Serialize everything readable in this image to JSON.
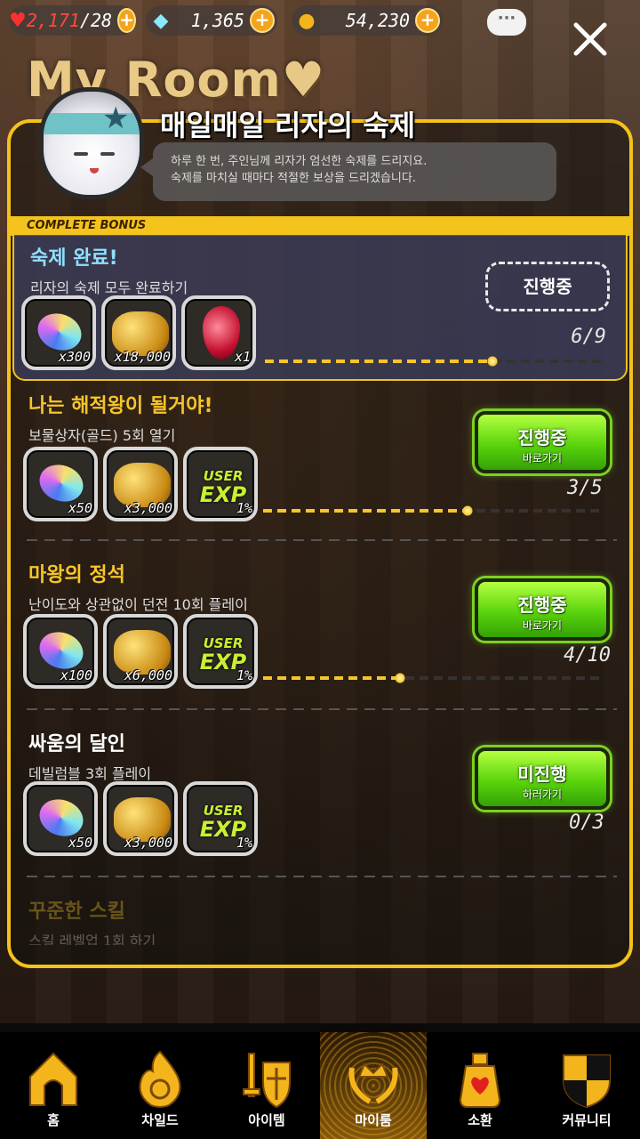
{
  "status": {
    "hearts_current": "2,171",
    "hearts_max": "/28",
    "gems": "1,365",
    "gold": "54,230",
    "chat_label": "···"
  },
  "header": {
    "myroom_title": "My Room♥",
    "quest_title": "매일매일 리자의 숙제",
    "speech_line1": "하루 한 번, 주인님께 리자가 엄선한 숙제를 드리지요.",
    "speech_line2": "숙제를 마치실 때마다 적절한 보상을 드리겠습니다."
  },
  "complete_bonus": {
    "label": "COMPLETE BONUS",
    "title": "숙제 완료!",
    "desc": "리자의 숙제 모두 완료하기",
    "button": "진행중",
    "progress": "6/9",
    "progress_fraction": 0.667,
    "rewards": [
      {
        "icon": "gem-icon",
        "qty": "x300"
      },
      {
        "icon": "gold-coins-icon",
        "qty": "x18,000"
      },
      {
        "icon": "ruby-icon",
        "qty": "x1"
      }
    ]
  },
  "missions": [
    {
      "title": "나는 해적왕이 될거야!",
      "desc": "보물상자(골드) 5회 열기",
      "button_main": "진행중",
      "button_sub": "바로가기",
      "progress": "3/5",
      "progress_fraction": 0.6,
      "title_color": "#f6c52a",
      "rewards": [
        {
          "icon": "gem-icon",
          "qty": "x50"
        },
        {
          "icon": "gold-coins-icon",
          "qty": "x3,000"
        },
        {
          "icon": "user-exp-icon",
          "qty": "1%",
          "exp_top": "USER",
          "exp_main": "EXP"
        }
      ]
    },
    {
      "title": "마왕의 정석",
      "desc": "난이도와 상관없이 던전 10회 플레이",
      "button_main": "진행중",
      "button_sub": "바로가기",
      "progress": "4/10",
      "progress_fraction": 0.4,
      "title_color": "#f6c52a",
      "rewards": [
        {
          "icon": "gem-icon",
          "qty": "x100"
        },
        {
          "icon": "gold-coins-icon",
          "qty": "x6,000"
        },
        {
          "icon": "user-exp-icon",
          "qty": "1%",
          "exp_top": "USER",
          "exp_main": "EXP"
        }
      ]
    },
    {
      "title": "싸움의 달인",
      "desc": "데빌럼블 3회 플레이",
      "button_main": "미진행",
      "button_sub": "하러가기",
      "progress": "0/3",
      "progress_fraction": 0,
      "title_color": "#ffffff",
      "rewards": [
        {
          "icon": "gem-icon",
          "qty": "x50"
        },
        {
          "icon": "gold-coins-icon",
          "qty": "x3,000"
        },
        {
          "icon": "user-exp-icon",
          "qty": "1%",
          "exp_top": "USER",
          "exp_main": "EXP"
        }
      ]
    },
    {
      "title": "꾸준한 스킬",
      "desc": "스킬 레벨업 1회 하기"
    }
  ],
  "nav": [
    {
      "label": "홈",
      "icon": "home-icon"
    },
    {
      "label": "차일드",
      "icon": "child-flame-icon"
    },
    {
      "label": "아이템",
      "icon": "sword-shield-icon"
    },
    {
      "label": "마이룸",
      "icon": "crown-laurel-icon",
      "active": true
    },
    {
      "label": "소환",
      "icon": "summon-potion-icon"
    },
    {
      "label": "커뮤니티",
      "icon": "community-shield-icon"
    }
  ],
  "colors": {
    "accent_yellow": "#f3c21b",
    "button_green": "#5ad40c",
    "panel_blue": "#3c3e5c"
  }
}
